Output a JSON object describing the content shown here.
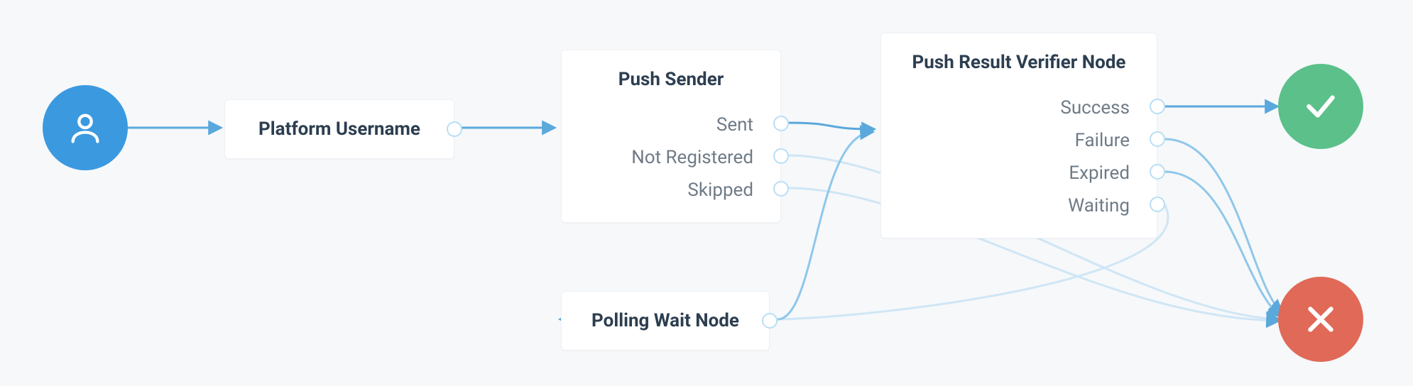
{
  "start": {
    "icon": "user-icon"
  },
  "nodes": {
    "platform_username": {
      "title": "Platform Username",
      "outputs": []
    },
    "push_sender": {
      "title": "Push Sender",
      "outputs": [
        "Sent",
        "Not Registered",
        "Skipped"
      ]
    },
    "push_result_verifier": {
      "title": "Push Result Verifier Node",
      "outputs": [
        "Success",
        "Failure",
        "Expired",
        "Waiting"
      ]
    },
    "polling_wait": {
      "title": "Polling Wait Node",
      "outputs": []
    }
  },
  "end": {
    "success": {
      "icon": "check-icon"
    },
    "failure": {
      "icon": "cross-icon"
    }
  },
  "colors": {
    "accent": "#3b99e0",
    "wire": "#8fc7ea",
    "wireLight": "#cfe6f5",
    "success": "#5bc08a",
    "fail": "#e06a57",
    "text": "#2c3e50",
    "muted": "#6f7b87"
  },
  "edges": [
    {
      "from": "start",
      "to": "platform_username.in"
    },
    {
      "from": "platform_username.out",
      "to": "push_sender.in"
    },
    {
      "from": "push_sender.Sent",
      "to": "push_result_verifier.in"
    },
    {
      "from": "push_sender.Not Registered",
      "to": "failure"
    },
    {
      "from": "push_sender.Skipped",
      "to": "failure"
    },
    {
      "from": "push_result_verifier.Success",
      "to": "success"
    },
    {
      "from": "push_result_verifier.Failure",
      "to": "failure"
    },
    {
      "from": "push_result_verifier.Expired",
      "to": "failure"
    },
    {
      "from": "push_result_verifier.Waiting",
      "to": "polling_wait.in"
    },
    {
      "from": "polling_wait.out",
      "to": "push_result_verifier.in"
    }
  ]
}
